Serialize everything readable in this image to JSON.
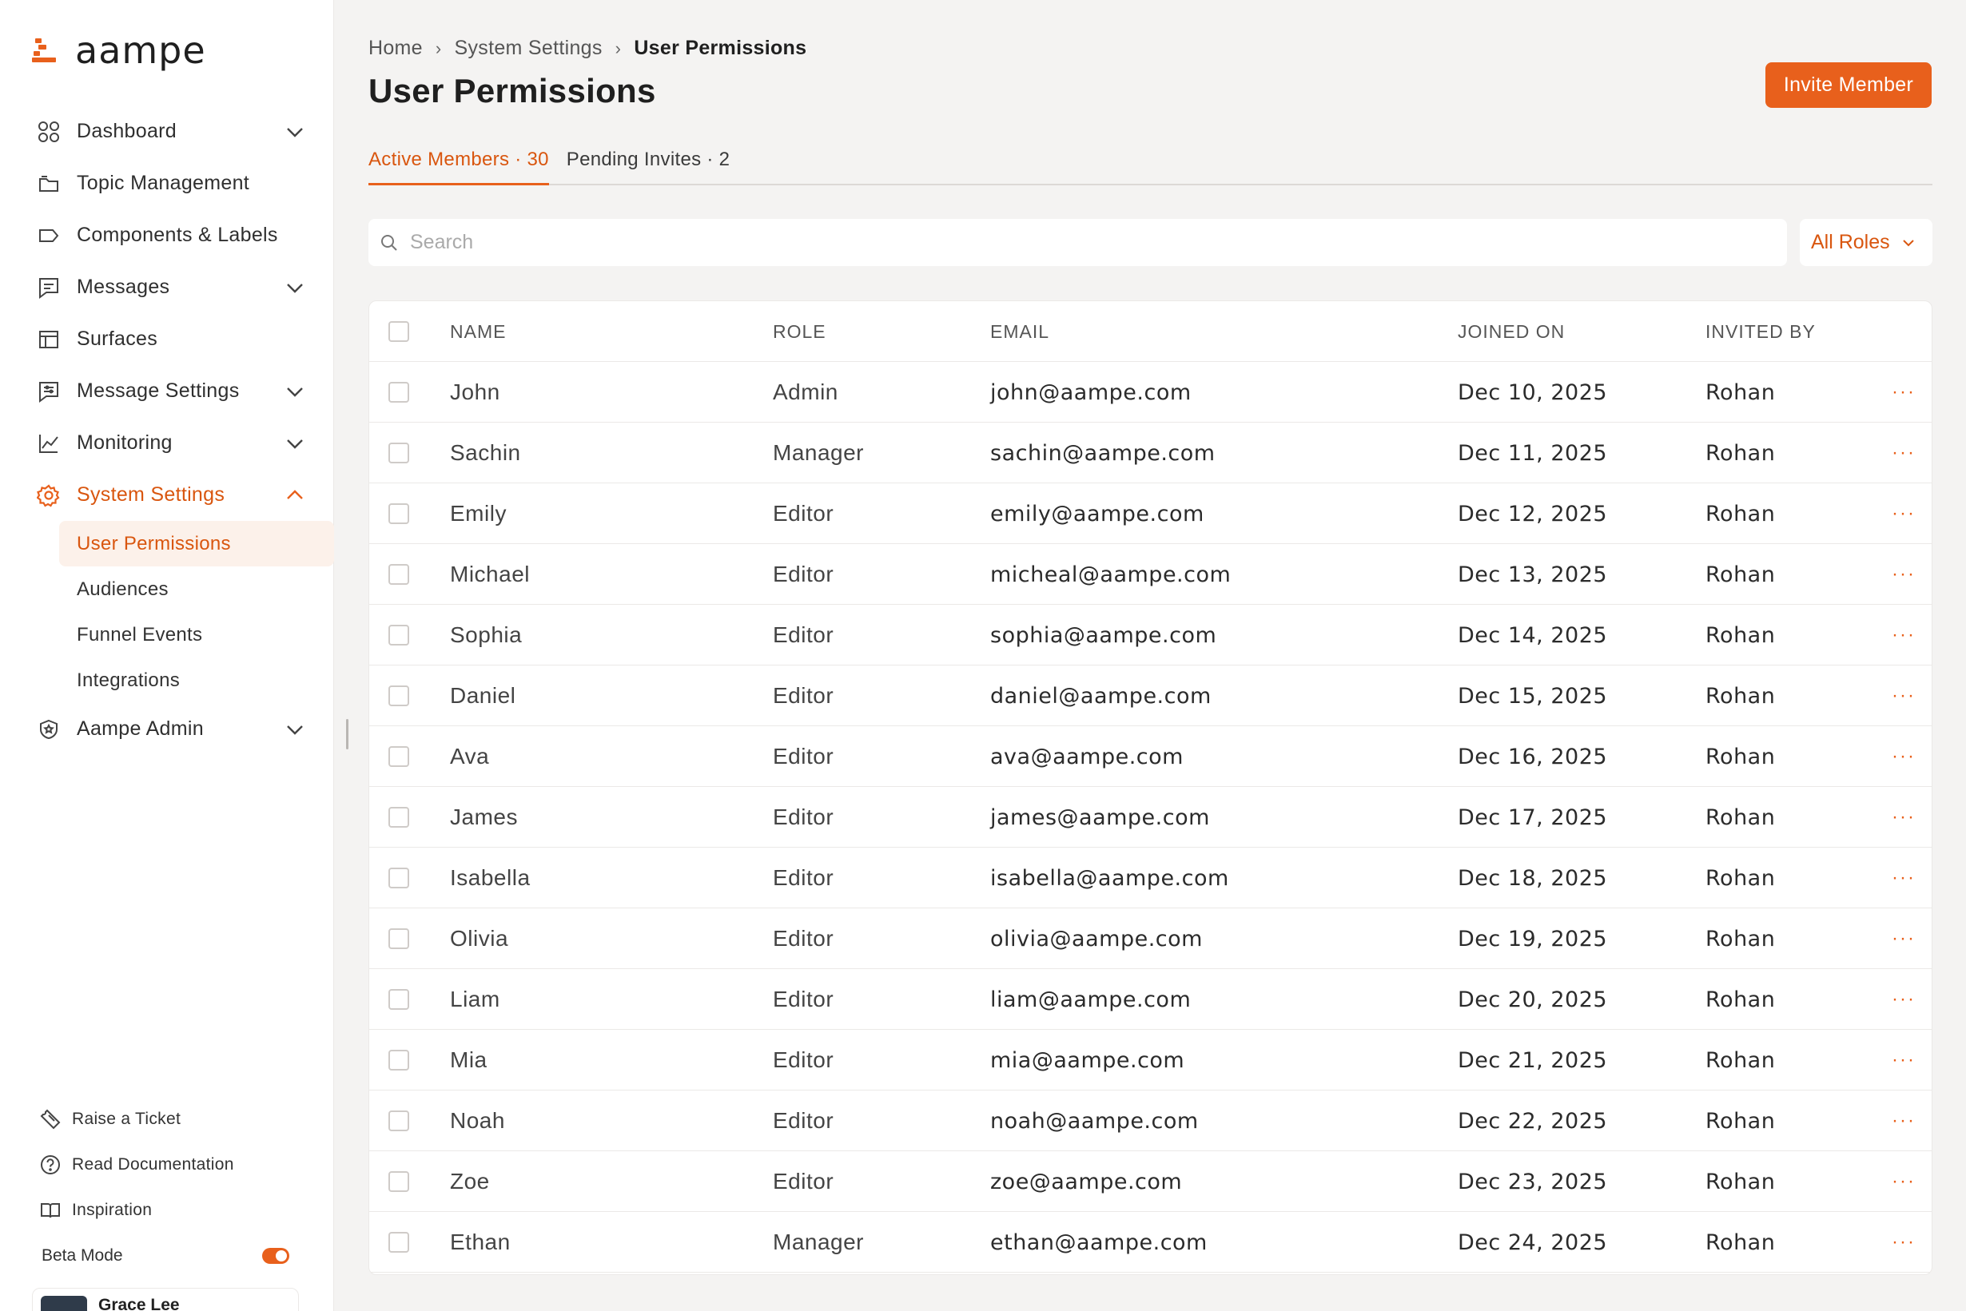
{
  "app": {
    "name": "aampe"
  },
  "colors": {
    "accent": "#e8601c",
    "accent_text": "#d9560f",
    "background": "#f4f3f2"
  },
  "sidebar": {
    "items": [
      {
        "label": "Dashboard",
        "icon": "grid-icon",
        "expandable": true
      },
      {
        "label": "Topic Management",
        "icon": "folder-icon",
        "expandable": false
      },
      {
        "label": "Components & Labels",
        "icon": "tag-icon",
        "expandable": false
      },
      {
        "label": "Messages",
        "icon": "message-icon",
        "expandable": true
      },
      {
        "label": "Surfaces",
        "icon": "layout-icon",
        "expandable": false
      },
      {
        "label": "Message Settings",
        "icon": "message-settings-icon",
        "expandable": true
      },
      {
        "label": "Monitoring",
        "icon": "chart-icon",
        "expandable": true
      },
      {
        "label": "System Settings",
        "icon": "gear-icon",
        "expandable": true,
        "expanded": true,
        "active": true
      },
      {
        "label": "Aampe Admin",
        "icon": "shield-icon",
        "expandable": true
      }
    ],
    "system_settings_children": [
      {
        "label": "User Permissions",
        "active": true
      },
      {
        "label": "Audiences"
      },
      {
        "label": "Funnel Events"
      },
      {
        "label": "Integrations"
      }
    ],
    "bottom_links": [
      {
        "label": "Raise a Ticket",
        "icon": "ticket-icon"
      },
      {
        "label": "Read Documentation",
        "icon": "help-icon"
      },
      {
        "label": "Inspiration",
        "icon": "book-icon"
      }
    ],
    "beta_mode_label": "Beta Mode",
    "beta_mode_on": true,
    "user_name": "Grace Lee"
  },
  "breadcrumb": [
    "Home",
    "System Settings",
    "User Permissions"
  ],
  "page_title": "User Permissions",
  "invite_button_label": "Invite Member",
  "tabs": [
    {
      "label": "Active Members · 30",
      "active": true
    },
    {
      "label": "Pending Invites · 2",
      "active": false
    }
  ],
  "search": {
    "placeholder": "Search",
    "value": ""
  },
  "role_filter": {
    "selected": "All Roles"
  },
  "table": {
    "columns": [
      "NAME",
      "ROLE",
      "EMAIL",
      "JOINED ON",
      "INVITED BY"
    ],
    "more_label": "···",
    "rows": [
      {
        "name": "John",
        "role": "Admin",
        "email": "john@aampe.com",
        "joined": "Dec 10, 2025",
        "invited_by": "Rohan"
      },
      {
        "name": "Sachin",
        "role": "Manager",
        "email": "sachin@aampe.com",
        "joined": "Dec 11, 2025",
        "invited_by": "Rohan"
      },
      {
        "name": "Emily",
        "role": "Editor",
        "email": "emily@aampe.com",
        "joined": "Dec 12, 2025",
        "invited_by": "Rohan"
      },
      {
        "name": "Michael",
        "role": "Editor",
        "email": "micheal@aampe.com",
        "joined": "Dec 13, 2025",
        "invited_by": "Rohan"
      },
      {
        "name": "Sophia",
        "role": "Editor",
        "email": "sophia@aampe.com",
        "joined": "Dec 14, 2025",
        "invited_by": "Rohan"
      },
      {
        "name": "Daniel",
        "role": "Editor",
        "email": "daniel@aampe.com",
        "joined": "Dec 15, 2025",
        "invited_by": "Rohan"
      },
      {
        "name": "Ava",
        "role": "Editor",
        "email": "ava@aampe.com",
        "joined": "Dec 16, 2025",
        "invited_by": "Rohan"
      },
      {
        "name": "James",
        "role": "Editor",
        "email": "james@aampe.com",
        "joined": "Dec 17, 2025",
        "invited_by": "Rohan"
      },
      {
        "name": "Isabella",
        "role": "Editor",
        "email": "isabella@aampe.com",
        "joined": "Dec 18, 2025",
        "invited_by": "Rohan"
      },
      {
        "name": "Olivia",
        "role": "Editor",
        "email": "olivia@aampe.com",
        "joined": "Dec 19, 2025",
        "invited_by": "Rohan"
      },
      {
        "name": "Liam",
        "role": "Editor",
        "email": "liam@aampe.com",
        "joined": "Dec 20, 2025",
        "invited_by": "Rohan"
      },
      {
        "name": "Mia",
        "role": "Editor",
        "email": "mia@aampe.com",
        "joined": "Dec 21, 2025",
        "invited_by": "Rohan"
      },
      {
        "name": "Noah",
        "role": "Editor",
        "email": "noah@aampe.com",
        "joined": "Dec 22, 2025",
        "invited_by": "Rohan"
      },
      {
        "name": "Zoe",
        "role": "Editor",
        "email": "zoe@aampe.com",
        "joined": "Dec 23, 2025",
        "invited_by": "Rohan"
      },
      {
        "name": "Ethan",
        "role": "Manager",
        "email": "ethan@aampe.com",
        "joined": "Dec 24, 2025",
        "invited_by": "Rohan"
      }
    ]
  }
}
